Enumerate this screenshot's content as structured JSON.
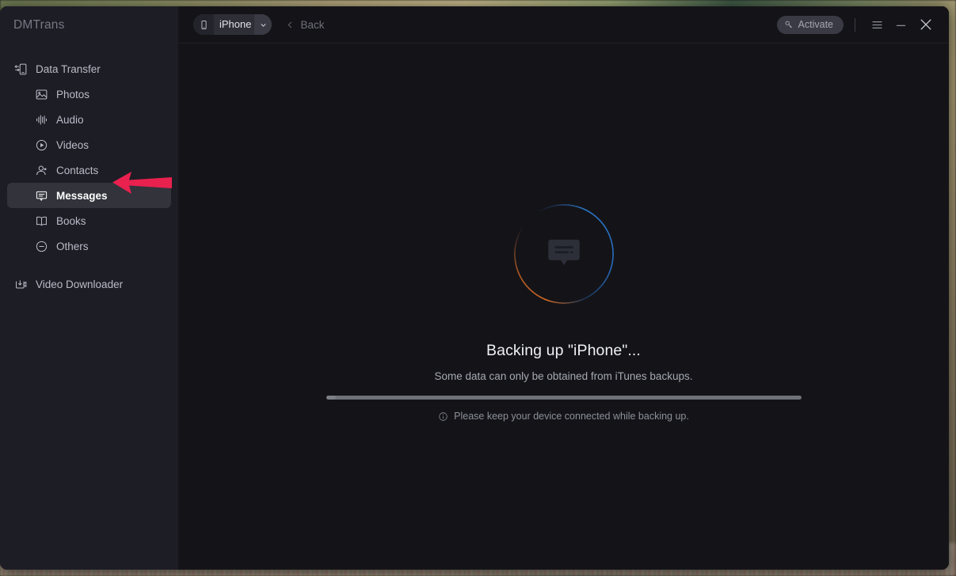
{
  "app": {
    "brand": "DMTrans"
  },
  "sidebar": {
    "items": [
      {
        "label": "Data Transfer",
        "icon": "phone-transfer-icon",
        "child": false,
        "selected": false
      },
      {
        "label": "Photos",
        "icon": "photo-icon",
        "child": true,
        "selected": false
      },
      {
        "label": "Audio",
        "icon": "audio-wave-icon",
        "child": true,
        "selected": false
      },
      {
        "label": "Videos",
        "icon": "play-circle-icon",
        "child": true,
        "selected": false
      },
      {
        "label": "Contacts",
        "icon": "contact-person-icon",
        "child": true,
        "selected": false
      },
      {
        "label": "Messages",
        "icon": "message-bubble-icon",
        "child": true,
        "selected": true
      },
      {
        "label": "Books",
        "icon": "book-icon",
        "child": true,
        "selected": false
      },
      {
        "label": "Others",
        "icon": "circle-minus-icon",
        "child": true,
        "selected": false
      },
      {
        "label": "Video Downloader",
        "icon": "video-download-icon",
        "child": false,
        "selected": false
      }
    ]
  },
  "titlebar": {
    "device_name": "iPhone",
    "device_icon": "phone-icon",
    "caret_icon": "chevron-down-icon",
    "back_label": "Back",
    "back_icon": "chevron-left-icon",
    "activate_label": "Activate",
    "activate_icon": "key-icon",
    "menu_icon": "hamburger-menu-icon",
    "minimize_icon": "minimize-icon",
    "close_icon": "close-icon"
  },
  "status": {
    "icon": "message-bubble-icon",
    "spinner_icon": "loading-ring-icon",
    "title": "Backing up \"iPhone\"...",
    "subtitle": "Some data can only be obtained from iTunes backups.",
    "progress_percent": 2,
    "hint_icon": "info-icon",
    "hint": "Please keep your device connected while backing up."
  },
  "annotation": {
    "arrow_icon": "left-pointing-arrow-annotation",
    "arrow_color": "#E8214E",
    "points_at": "Messages"
  },
  "colors": {
    "window_bg": "#141418",
    "sidebar_bg": "#1d1d25",
    "selected_item_bg": "#33333c",
    "accent_blue": "#2d78cd",
    "accent_orange": "#df6e26",
    "annotation_pink": "#E8214E"
  }
}
